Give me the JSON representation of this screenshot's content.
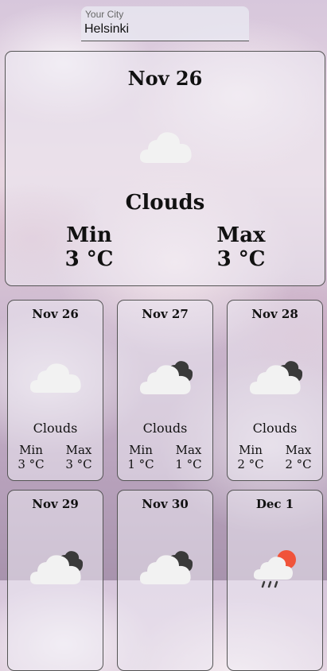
{
  "city": {
    "label": "Your City",
    "value": "Helsinki"
  },
  "today": {
    "date": "Nov 26",
    "condition": "Clouds",
    "icon": "cloud-icon",
    "min_label": "Min",
    "min_value": "3 °C",
    "max_label": "Max",
    "max_value": "3 °C"
  },
  "forecast": [
    {
      "date": "Nov 26",
      "condition": "Clouds",
      "icon": "cloud-icon",
      "min_label": "Min",
      "min_value": "3 °C",
      "max_label": "Max",
      "max_value": "3 °C"
    },
    {
      "date": "Nov 27",
      "condition": "Clouds",
      "icon": "broken-clouds-icon",
      "min_label": "Min",
      "min_value": "1 °C",
      "max_label": "Max",
      "max_value": "1 °C"
    },
    {
      "date": "Nov 28",
      "condition": "Clouds",
      "icon": "broken-clouds-icon",
      "min_label": "Min",
      "min_value": "2 °C",
      "max_label": "Max",
      "max_value": "2 °C"
    },
    {
      "date": "Nov 29",
      "icon": "broken-clouds-icon"
    },
    {
      "date": "Nov 30",
      "icon": "broken-clouds-icon"
    },
    {
      "date": "Dec 1",
      "icon": "sun-cloud-rain-icon"
    }
  ],
  "colors": {
    "cloud_light": "#f2f2f2",
    "cloud_dark": "#3a3a3a",
    "sun": "#f0533a",
    "border": "#555555"
  }
}
